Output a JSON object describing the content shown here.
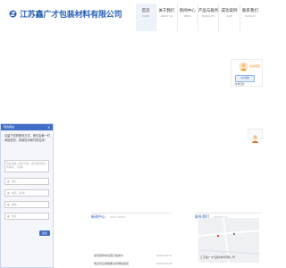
{
  "header": {
    "company_name": "江苏鑫广才包装材料有限公司"
  },
  "nav": [
    {
      "zh": "首页",
      "en": "HOME"
    },
    {
      "zh": "关于我们",
      "en": "ABOUT US"
    },
    {
      "zh": "新闻中心",
      "en": "NEWS"
    },
    {
      "zh": "产品与服务",
      "en": "PRODUCTS"
    },
    {
      "zh": "成功案例",
      "en": "CASE"
    },
    {
      "zh": "联系我们",
      "en": "CONTACT"
    }
  ],
  "nav_active_index": 0,
  "qq": {
    "title": "在线客服",
    "button": "QQ咨询",
    "subtitle": "在线咨询"
  },
  "message": {
    "title": "我的留言",
    "close": "×",
    "intro": "请留下您的联系方式，我们会第一时间回复您，感谢您对我们的支持！",
    "textarea_placeholder": "请在此输入留言内容，我们会尽快与您联系。（必填）",
    "name_placeholder": "姓名",
    "phone_placeholder": "电话（必填）",
    "email_placeholder": "邮箱",
    "address_placeholder": "地址",
    "submit": "提交"
  },
  "sections": {
    "news": {
      "zh": "新闻中心",
      "en": "NEWS CENTER"
    },
    "contact": {
      "zh": "联系我们",
      "en": "CONTACT US"
    }
  },
  "news_items": [
    {
      "title": "如何把你的包装打造成IP",
      "date": "2019-09-11"
    },
    {
      "title": "购买真空袋需要注意哪些事项",
      "date": "2019-09-09"
    }
  ],
  "map": {
    "caption": "江苏鑫广才包装材料有限公司"
  },
  "colors": {
    "brand_blue": "#2a61b6",
    "panel_blue": "#3f6ec4",
    "qq_orange": "#f19a28"
  }
}
